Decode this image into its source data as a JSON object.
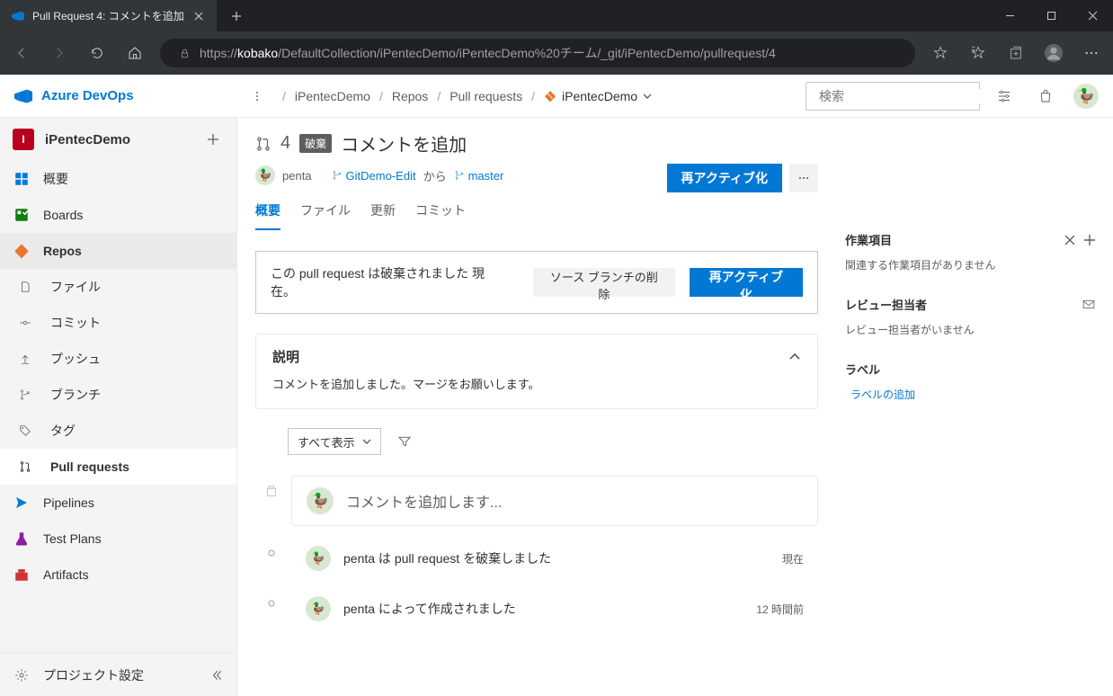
{
  "browser": {
    "tab_title": "Pull Request 4: コメントを追加",
    "url_prefix": "https://",
    "url_host": "kobako",
    "url_path": "/DefaultCollection/iPentecDemo/iPentecDemo%20チーム/_git/iPentecDemo/pullrequest/4"
  },
  "header": {
    "brand": "Azure DevOps",
    "crumbs": {
      "project": "iPentecDemo",
      "repos": "Repos",
      "pull_requests": "Pull requests",
      "repo": "iPentecDemo"
    },
    "search_placeholder": "検索"
  },
  "sidebar": {
    "project": "iPentecDemo",
    "items": {
      "overview": "概要",
      "boards": "Boards",
      "repos": "Repos",
      "files": "ファイル",
      "commits": "コミット",
      "pushes": "プッシュ",
      "branches": "ブランチ",
      "tags": "タグ",
      "pull_requests": "Pull requests",
      "pipelines": "Pipelines",
      "test_plans": "Test Plans",
      "artifacts": "Artifacts"
    },
    "settings": "プロジェクト設定"
  },
  "pr": {
    "number": "4",
    "status_badge": "破棄",
    "title": "コメントを追加",
    "author": "penta",
    "source_branch": "GitDemo-Edit",
    "from_label": "から",
    "target_branch": "master",
    "reactivate_btn": "再アクティブ化",
    "tabs": {
      "overview": "概要",
      "files": "ファイル",
      "updates": "更新",
      "commits": "コミット"
    },
    "banner": {
      "text": "この pull request は破棄されました 現在。",
      "delete_source": "ソース ブランチの削除",
      "reactivate": "再アクティブ化"
    },
    "description": {
      "head": "説明",
      "body": "コメントを追加しました。マージをお願いします。"
    },
    "activity": {
      "show_all": "すべて表示",
      "add_comment_placeholder": "コメントを追加します...",
      "items": [
        {
          "text": "penta は pull request を破棄しました",
          "time": "現在"
        },
        {
          "text": "penta によって作成されました",
          "time": "12 時間前"
        }
      ]
    }
  },
  "right": {
    "work_items": {
      "head": "作業項目",
      "empty": "関連する作業項目がありません"
    },
    "reviewers": {
      "head": "レビュー担当者",
      "empty": "レビュー担当者がいません"
    },
    "labels": {
      "head": "ラベル",
      "add": "ラベルの追加"
    }
  }
}
